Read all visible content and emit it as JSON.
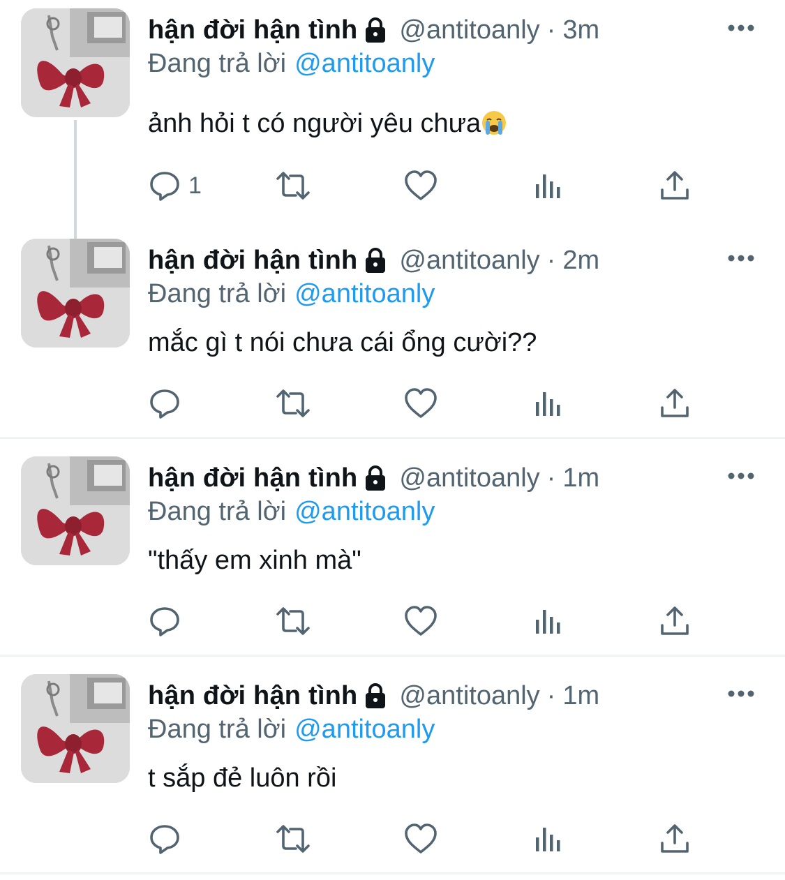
{
  "tweets": [
    {
      "display_name": "hận đời hận tình",
      "handle": "@antitoanly",
      "separator": "·",
      "time": "3m",
      "replying_label": "Đang trả lời",
      "replying_handle": "@antitoanly",
      "text": "ảnh hỏi t có người yêu chưa",
      "emoji": "loudly-crying-face-emoji",
      "reply_count": "1",
      "icons": {
        "lock": "lock-icon",
        "more": "more-icon",
        "reply": "reply-icon",
        "retweet": "retweet-icon",
        "like": "heart-icon",
        "views": "views-icon",
        "share": "share-icon"
      }
    },
    {
      "display_name": "hận đời hận tình",
      "handle": "@antitoanly",
      "separator": "·",
      "time": "2m",
      "replying_label": "Đang trả lời",
      "replying_handle": "@antitoanly",
      "text": "mắc gì t nói chưa cái ổng cười??",
      "reply_count": ""
    },
    {
      "display_name": "hận đời hận tình",
      "handle": "@antitoanly",
      "separator": "·",
      "time": "1m",
      "replying_label": "Đang trả lời",
      "replying_handle": "@antitoanly",
      "text": "\"thấy em xinh mà\"",
      "reply_count": ""
    },
    {
      "display_name": "hận đời hận tình",
      "handle": "@antitoanly",
      "separator": "·",
      "time": "1m",
      "replying_label": "Đang trả lời",
      "replying_handle": "@antitoanly",
      "text": "t sắp đẻ luôn rồi",
      "reply_count": ""
    }
  ],
  "colors": {
    "text": "#0f1419",
    "secondary": "#536471",
    "link": "#1d9bf0",
    "divider": "#eff3f4",
    "thread_line": "#cfd9de",
    "avatar_bow": "#a8283a"
  }
}
